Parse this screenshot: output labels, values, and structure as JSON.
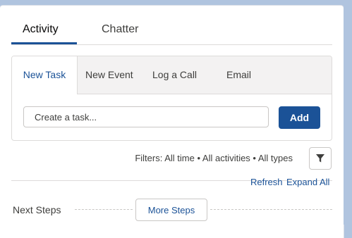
{
  "tabs": {
    "activity": "Activity",
    "chatter": "Chatter"
  },
  "publisher": {
    "tabs": [
      "New Task",
      "New Event",
      "Log a Call",
      "Email"
    ],
    "active_tab": "New Task",
    "input_placeholder": "Create a task...",
    "add_label": "Add"
  },
  "filters": {
    "text": "Filters: All time • All activities • All types",
    "icon": "filter-icon"
  },
  "links": {
    "refresh": "Refresh",
    "expand_all": "Expand All"
  },
  "next_steps": {
    "label": "Next Steps",
    "more_label": "More Steps"
  },
  "colors": {
    "accent": "#1b5297",
    "background": "#b0c4df",
    "tab_bar": "#f3f2f2",
    "border": "#dddbda"
  }
}
